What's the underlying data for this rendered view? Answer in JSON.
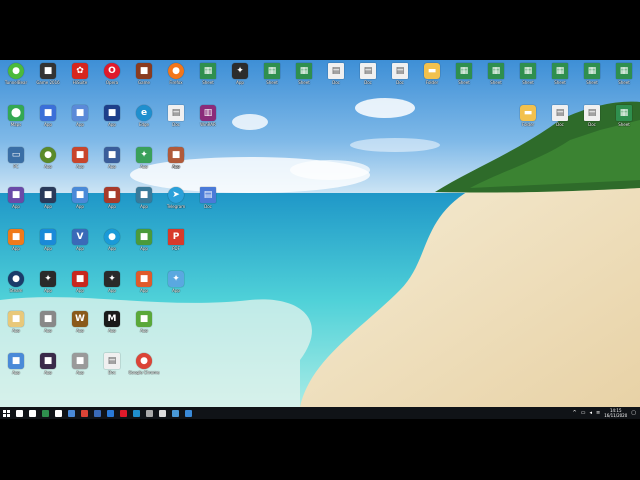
{
  "desktop": {
    "icons": [
      {
        "name": "tunnelbear-icon",
        "label": "TunnelBear",
        "glyph": "●",
        "color": "#4cba3c",
        "shape": "round"
      },
      {
        "name": "game-icon",
        "label": "Game 2016",
        "glyph": "■",
        "color": "#333333",
        "shape": "sq"
      },
      {
        "name": "huawei-icon",
        "label": "HiSuite",
        "glyph": "✿",
        "color": "#d6261e",
        "shape": "sq"
      },
      {
        "name": "opera-icon",
        "label": "Opera",
        "glyph": "O",
        "color": "#e01a2b",
        "shape": "round"
      },
      {
        "name": "game-cover-icon",
        "label": "Game",
        "glyph": "■",
        "color": "#8a3b1f",
        "shape": "sq"
      },
      {
        "name": "firefox-icon",
        "label": "Firefox",
        "glyph": "●",
        "color": "#f3761b",
        "shape": "round"
      },
      {
        "name": "spreadsheet-icon",
        "label": "Sheet",
        "glyph": "▦",
        "color": "#2f8f4e",
        "shape": "doc"
      },
      {
        "name": "app-icon",
        "label": "App",
        "glyph": "✦",
        "color": "#2c2c2c",
        "shape": "sq"
      },
      {
        "name": "spreadsheet-icon",
        "label": "Sheet",
        "glyph": "▦",
        "color": "#2f8f4e",
        "shape": "doc"
      },
      {
        "name": "spreadsheet-icon",
        "label": "Sheet",
        "glyph": "▦",
        "color": "#2f8f4e",
        "shape": "doc"
      },
      {
        "name": "document-icon",
        "label": "Doc",
        "glyph": "▤",
        "color": "#f0f0f0",
        "shape": "doc"
      },
      {
        "name": "document-icon",
        "label": "Doc",
        "glyph": "▤",
        "color": "#f0f0f0",
        "shape": "doc"
      },
      {
        "name": "document-icon",
        "label": "Doc",
        "glyph": "▤",
        "color": "#f0f0f0",
        "shape": "doc"
      },
      {
        "name": "folder-icon",
        "label": "Folder",
        "glyph": "▬",
        "color": "#f2c14e",
        "shape": "sq"
      },
      {
        "name": "spreadsheet-icon",
        "label": "Sheet",
        "glyph": "▦",
        "color": "#2f8f4e",
        "shape": "doc"
      },
      {
        "name": "spreadsheet-icon",
        "label": "Sheet",
        "glyph": "▦",
        "color": "#2f8f4e",
        "shape": "doc"
      },
      {
        "name": "spreadsheet-icon",
        "label": "Sheet",
        "glyph": "▦",
        "color": "#2f8f4e",
        "shape": "doc"
      },
      {
        "name": "spreadsheet-icon",
        "label": "Sheet",
        "glyph": "▦",
        "color": "#2f8f4e",
        "shape": "doc"
      },
      {
        "name": "spreadsheet-icon",
        "label": "Sheet",
        "glyph": "▦",
        "color": "#2f8f4e",
        "shape": "doc"
      },
      {
        "name": "spreadsheet-icon",
        "label": "Sheet",
        "glyph": "▦",
        "color": "#2f8f4e",
        "shape": "doc"
      },
      {
        "name": "google-maps-icon",
        "label": "Maps",
        "glyph": "⬤",
        "color": "#34a853",
        "shape": "sq"
      },
      {
        "name": "app-icon",
        "label": "App",
        "glyph": "■",
        "color": "#3b6fd8",
        "shape": "sq"
      },
      {
        "name": "app-icon",
        "label": "App",
        "glyph": "■",
        "color": "#5b8ad8",
        "shape": "sq"
      },
      {
        "name": "app-icon",
        "label": "App",
        "glyph": "■",
        "color": "#1e3f8a",
        "shape": "sq"
      },
      {
        "name": "edge-icon",
        "label": "Edge",
        "glyph": "e",
        "color": "#1f8fce",
        "shape": "round"
      },
      {
        "name": "document-icon",
        "label": "Doc",
        "glyph": "▤",
        "color": "#f0f0f0",
        "shape": "doc"
      },
      {
        "name": "winrar-icon",
        "label": "WinRAR",
        "glyph": "▥",
        "color": "#8b2b7a",
        "shape": "sq"
      },
      {
        "name": "folder-icon",
        "label": "Folder",
        "glyph": "▬",
        "color": "#f2c14e",
        "shape": "sq"
      },
      {
        "name": "document-icon",
        "label": "Doc",
        "glyph": "▤",
        "color": "#f0f0f0",
        "shape": "doc"
      },
      {
        "name": "document-icon",
        "label": "Doc",
        "glyph": "▤",
        "color": "#f0f0f0",
        "shape": "doc"
      },
      {
        "name": "spreadsheet-icon",
        "label": "Sheet",
        "glyph": "▦",
        "color": "#2f8f4e",
        "shape": "doc"
      },
      {
        "name": "this-pc-icon",
        "label": "PC",
        "glyph": "▭",
        "color": "#3a6ea5",
        "shape": "sq"
      },
      {
        "name": "app-icon",
        "label": "App",
        "glyph": "●",
        "color": "#5a8a2a",
        "shape": "round"
      },
      {
        "name": "app-icon",
        "label": "App",
        "glyph": "■",
        "color": "#c8452c",
        "shape": "sq"
      },
      {
        "name": "app-icon",
        "label": "App",
        "glyph": "■",
        "color": "#3a5d9a",
        "shape": "sq"
      },
      {
        "name": "app-icon",
        "label": "App",
        "glyph": "✦",
        "color": "#3aa05a",
        "shape": "sq"
      },
      {
        "name": "app-icon",
        "label": "App",
        "glyph": "●",
        "color": "#222222",
        "shape": "round"
      },
      {
        "name": "app-icon",
        "label": "App",
        "glyph": "■",
        "color": "#b05a3a",
        "shape": "sq"
      },
      {
        "name": "app-icon",
        "label": "App",
        "glyph": "■",
        "color": "#6a4aa8",
        "shape": "sq"
      },
      {
        "name": "app-icon",
        "label": "App",
        "glyph": "■",
        "color": "#2a3a5a",
        "shape": "sq"
      },
      {
        "name": "app-icon",
        "label": "App",
        "glyph": "■",
        "color": "#4a8ad8",
        "shape": "sq"
      },
      {
        "name": "app-icon",
        "label": "App",
        "glyph": "■",
        "color": "#a83a2a",
        "shape": "sq"
      },
      {
        "name": "app-icon",
        "label": "App",
        "glyph": "■",
        "color": "#3a7a9a",
        "shape": "sq"
      },
      {
        "name": "telegram-icon",
        "label": "Telegram",
        "glyph": "➤",
        "color": "#2aa1da",
        "shape": "round"
      },
      {
        "name": "document-icon",
        "label": "Doc",
        "glyph": "▤",
        "color": "#4a7ad8",
        "shape": "doc"
      },
      {
        "name": "app-icon",
        "label": "App",
        "glyph": "■",
        "color": "#f07a1a",
        "shape": "sq"
      },
      {
        "name": "app-icon",
        "label": "App",
        "glyph": "■",
        "color": "#1a8ad8",
        "shape": "sq"
      },
      {
        "name": "app-icon",
        "label": "App",
        "glyph": "V",
        "color": "#3a6ab8",
        "shape": "sq"
      },
      {
        "name": "app-icon",
        "label": "App",
        "glyph": "●",
        "color": "#1a9ad8",
        "shape": "round"
      },
      {
        "name": "app-icon",
        "label": "App",
        "glyph": "■",
        "color": "#4a9a3a",
        "shape": "sq"
      },
      {
        "name": "pdf-icon",
        "label": "PDF",
        "glyph": "P",
        "color": "#d83a2a",
        "shape": "doc"
      },
      {
        "name": "steam-icon",
        "label": "Steam",
        "glyph": "●",
        "color": "#1b3b6a",
        "shape": "round"
      },
      {
        "name": "app-icon",
        "label": "App",
        "glyph": "✦",
        "color": "#2a2a2a",
        "shape": "sq"
      },
      {
        "name": "app-icon",
        "label": "App",
        "glyph": "■",
        "color": "#c8281e",
        "shape": "sq"
      },
      {
        "name": "app-icon",
        "label": "App",
        "glyph": "✦",
        "color": "#2a2a2a",
        "shape": "sq"
      },
      {
        "name": "app-icon",
        "label": "App",
        "glyph": "■",
        "color": "#e05a2a",
        "shape": "sq"
      },
      {
        "name": "app-icon",
        "label": "App",
        "glyph": "✦",
        "color": "#5aa8e0",
        "shape": "sq"
      },
      {
        "name": "app-icon",
        "label": "App",
        "glyph": "■",
        "color": "#e8c87a",
        "shape": "sq"
      },
      {
        "name": "app-icon",
        "label": "App",
        "glyph": "■",
        "color": "#888888",
        "shape": "sq"
      },
      {
        "name": "app-icon",
        "label": "App",
        "glyph": "W",
        "color": "#8a5a1a",
        "shape": "sq"
      },
      {
        "name": "app-icon",
        "label": "App",
        "glyph": "M",
        "color": "#1a1a1a",
        "shape": "sq"
      },
      {
        "name": "app-icon",
        "label": "App",
        "glyph": "■",
        "color": "#5aa83a",
        "shape": "sq"
      },
      {
        "name": "app-icon",
        "label": "App",
        "glyph": "■",
        "color": "#4a8ad8",
        "shape": "sq"
      },
      {
        "name": "app-icon",
        "label": "App",
        "glyph": "■",
        "color": "#3a2a4a",
        "shape": "sq"
      },
      {
        "name": "app-icon",
        "label": "App",
        "glyph": "■",
        "color": "#9a9a9a",
        "shape": "sq"
      },
      {
        "name": "document-icon",
        "label": "Doc",
        "glyph": "▤",
        "color": "#f0f0f0",
        "shape": "doc"
      },
      {
        "name": "google-chrome-icon",
        "label": "Google Chrome",
        "glyph": "●",
        "color": "#db4437",
        "shape": "round"
      }
    ]
  },
  "taskbar": {
    "pinned": [
      {
        "name": "search-icon",
        "color": "#ffffff"
      },
      {
        "name": "task-view-icon",
        "color": "#ffffff"
      },
      {
        "name": "spreadsheet-taskbar-icon",
        "color": "#2f8f4e"
      },
      {
        "name": "store-icon",
        "color": "#ffffff"
      },
      {
        "name": "app-taskbar-icon",
        "color": "#4a8ad8"
      },
      {
        "name": "chrome-taskbar-icon",
        "color": "#db4437"
      },
      {
        "name": "app-taskbar-icon",
        "color": "#3a6ab8"
      },
      {
        "name": "mail-taskbar-icon",
        "color": "#2a7ad8"
      },
      {
        "name": "opera-taskbar-icon",
        "color": "#e01a2b"
      },
      {
        "name": "edge-taskbar-icon",
        "color": "#1f8fce"
      },
      {
        "name": "app-taskbar-icon",
        "color": "#aaaaaa"
      },
      {
        "name": "app-taskbar-icon",
        "color": "#dddddd"
      },
      {
        "name": "app-taskbar-icon",
        "color": "#4a9ad8"
      },
      {
        "name": "app-taskbar-icon",
        "color": "#3a8ad8"
      }
    ],
    "clock_time": "14:15",
    "clock_date": "16/11/2020"
  }
}
